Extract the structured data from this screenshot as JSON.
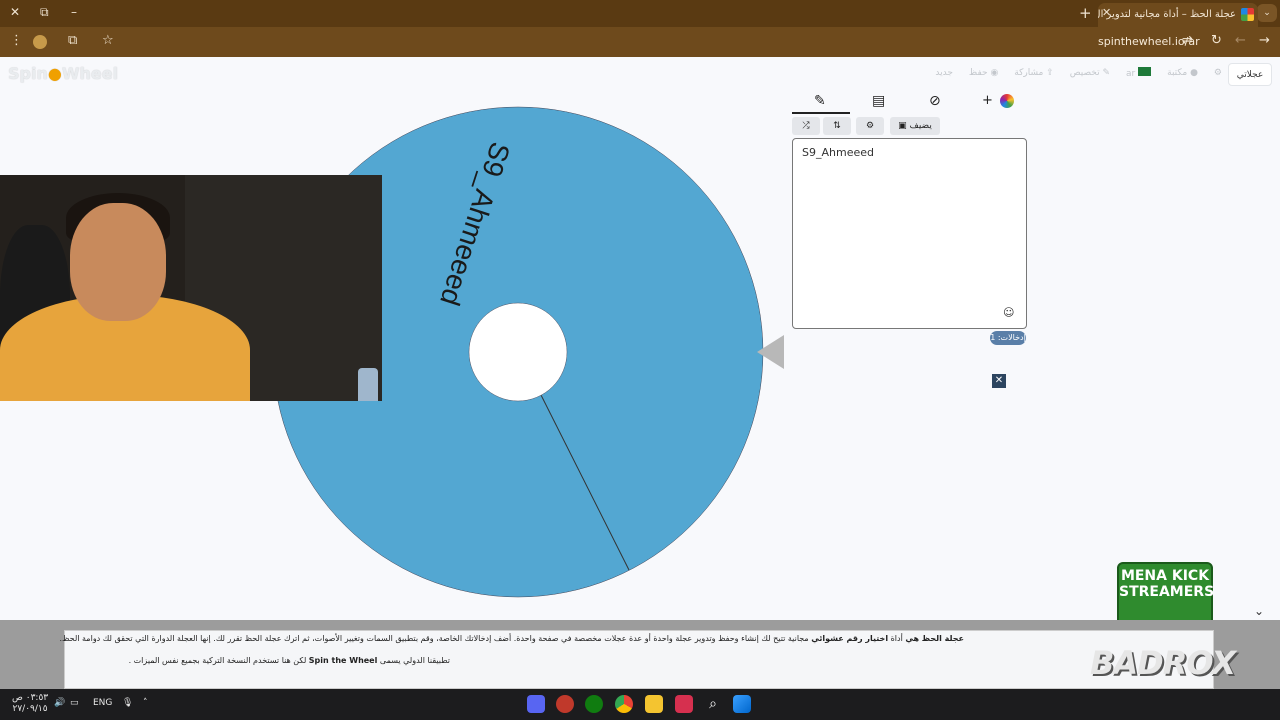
{
  "browser": {
    "tab_title": "عجلة الحظ – أداة مجانية لتدوير ال...",
    "url": "spinthewheel.io/ar",
    "icons": [
      "new-tab-icon",
      "tab-close-icon",
      "minimize-icon",
      "restore-icon",
      "close-icon",
      "tablist-icon",
      "menu-icon",
      "profile-icon",
      "extensions-icon",
      "bookmark-icon",
      "reload-icon",
      "back-icon",
      "forward-icon",
      "site-settings-icon"
    ]
  },
  "site": {
    "logo": "Spin",
    "logo2": "Wheel",
    "nav": {
      "my_wheels": "عجلاتي",
      "lang": "ar",
      "settings": "مكتبة",
      "customize": "تخصيص",
      "share": "مشاركة",
      "save": "حفظ",
      "new": "جديد"
    }
  },
  "wheel": {
    "segment_label": "S9_Ahmeeed",
    "color": "#53a7d2"
  },
  "panel": {
    "shuffle_icon": "shuffle-icon",
    "sort_icon": "sort-icon",
    "image_add_label": "يضيف",
    "entries_text": "S9_Ahmeeed",
    "entry_count": "إدخالات: 1"
  },
  "overlay": {
    "mena_line1": "MENA KICK",
    "mena_line2": "STREAMERS",
    "brand": "BADROX"
  },
  "footer": {
    "line1_bold": "عجلة الحظ هي",
    "line1_mid": "أداة",
    "line1_bold2": "اختيار رقم عشوائي",
    "line1_rest": "مجانية تتيح لك إنشاء وحفظ وتدوير عجلة واحدة أو عدة عجلات مخصصة في صفحة واحدة. أضف إدخالاتك الخاصة، وقم بتطبيق السمات وتغيير الأصوات، ثم اترك عجلة الحظ تقرر لك. إنها العجلة الدوارة التي تحقق لك دوامة الحظ.",
    "line2_pre": "لكن هنا تستخدم النسخة التركية بجميع نفس الميزات .",
    "line2_bold": "Spin the Wheel",
    "line2_post": "تطبيقنا الدولي يسمى"
  },
  "taskbar": {
    "time": "٠٣:٥٣ ص",
    "date": "٢٧/٠٩/١٥",
    "lang": "ENG"
  }
}
